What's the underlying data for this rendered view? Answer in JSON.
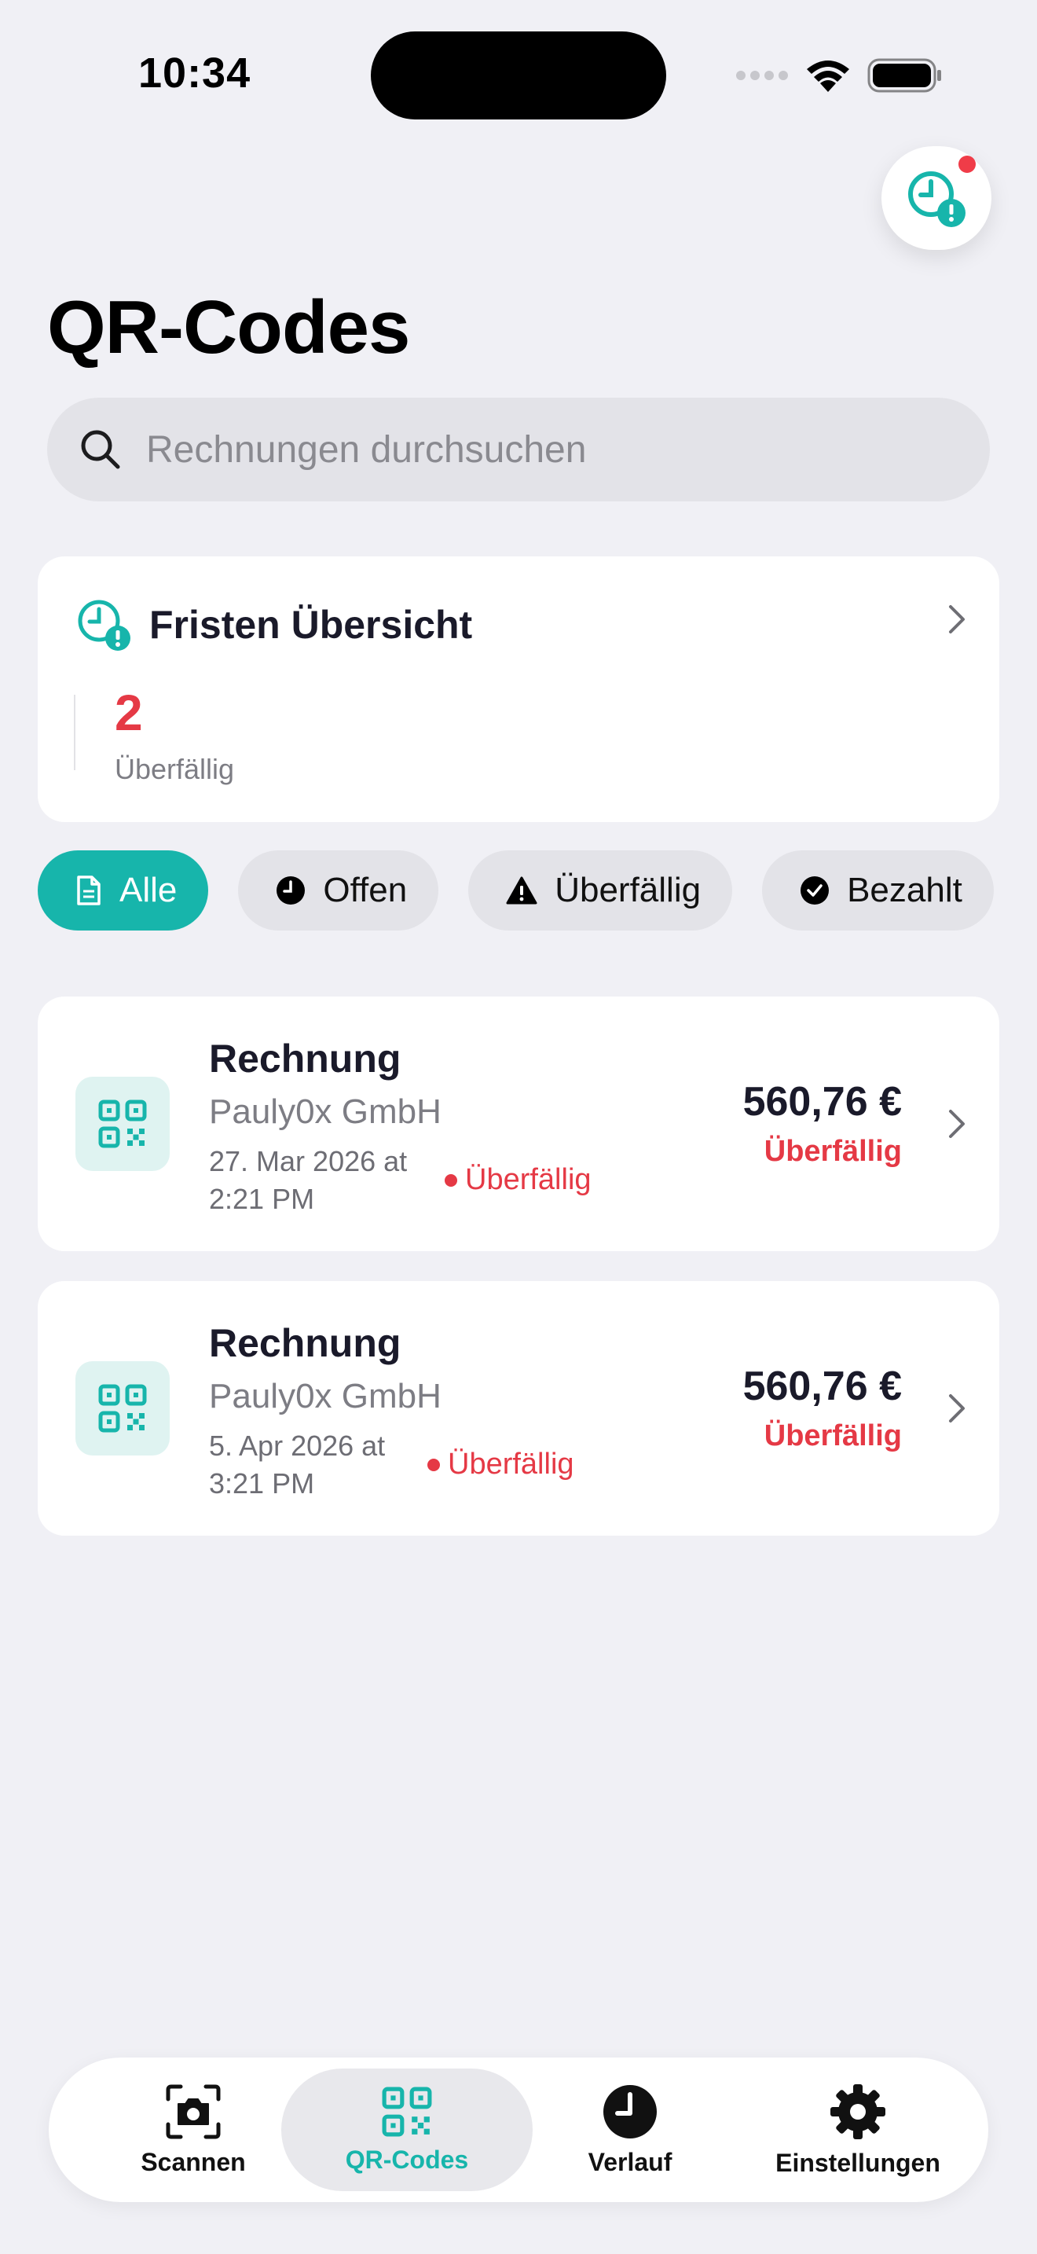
{
  "status_bar": {
    "time": "10:34"
  },
  "page": {
    "title": "QR-Codes"
  },
  "search": {
    "placeholder": "Rechnungen durchsuchen"
  },
  "deadlines": {
    "title": "Fristen Übersicht",
    "overdue_count": "2",
    "overdue_label": "Überfällig"
  },
  "filters": [
    {
      "label": "Alle",
      "icon": "document-icon",
      "active": true
    },
    {
      "label": "Offen",
      "icon": "clock-icon",
      "active": false
    },
    {
      "label": "Überfällig",
      "icon": "warning-icon",
      "active": false
    },
    {
      "label": "Bezahlt",
      "icon": "checkmark-icon",
      "active": false
    }
  ],
  "invoices": [
    {
      "title": "Rechnung",
      "vendor": "Pauly0x GmbH",
      "date": "27. Mar 2026 at 2:21 PM",
      "status": "Überfällig",
      "amount": "560,76 €",
      "badge": "Überfällig"
    },
    {
      "title": "Rechnung",
      "vendor": "Pauly0x GmbH",
      "date": "5. Apr 2026 at 3:21 PM",
      "status": "Überfällig",
      "amount": "560,76 €",
      "badge": "Überfällig"
    }
  ],
  "tabbar": [
    {
      "label": "Scannen",
      "icon": "camera-icon"
    },
    {
      "label": "QR-Codes",
      "icon": "qr-code-icon",
      "active": true
    },
    {
      "label": "Verlauf",
      "icon": "clock-icon"
    },
    {
      "label": "Einstellungen",
      "icon": "gear-icon"
    }
  ],
  "colors": {
    "accent": "#17b5ab",
    "danger": "#e53945",
    "background": "#f0f0f5"
  }
}
